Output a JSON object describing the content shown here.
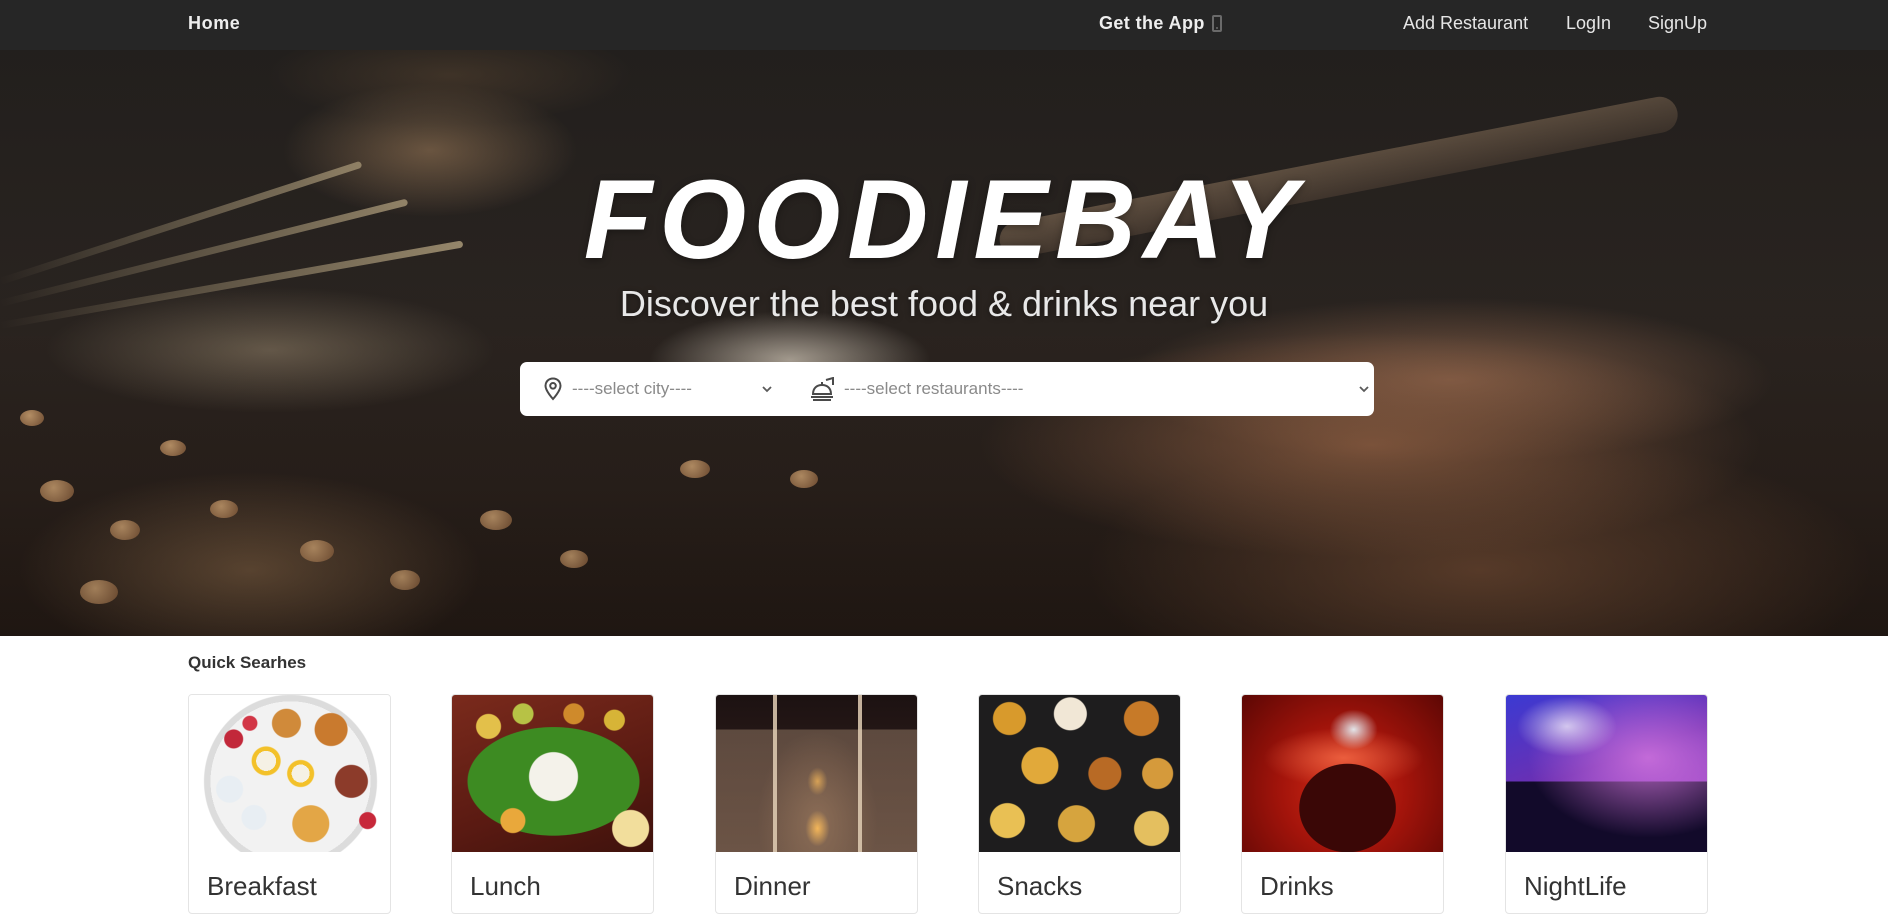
{
  "nav": {
    "home": "Home",
    "get_app": "Get the App",
    "add_restaurant": "Add Restaurant",
    "login": "LogIn",
    "signup": "SignUp"
  },
  "hero": {
    "brand": "FOODIEBAY",
    "tagline": "Discover the best food & drinks near you"
  },
  "search": {
    "city_placeholder": "----select city----",
    "restaurant_placeholder": "----select restaurants----"
  },
  "quick_searches": {
    "title": "Quick Searhes",
    "items": [
      {
        "label": "Breakfast"
      },
      {
        "label": "Lunch"
      },
      {
        "label": "Dinner"
      },
      {
        "label": "Snacks"
      },
      {
        "label": "Drinks"
      },
      {
        "label": "NightLife"
      }
    ]
  },
  "icons": {
    "location": "map-pin-icon",
    "restaurant": "food-tray-icon",
    "dropdown": "chevron-down-icon",
    "app": "mobile-phone-icon"
  }
}
